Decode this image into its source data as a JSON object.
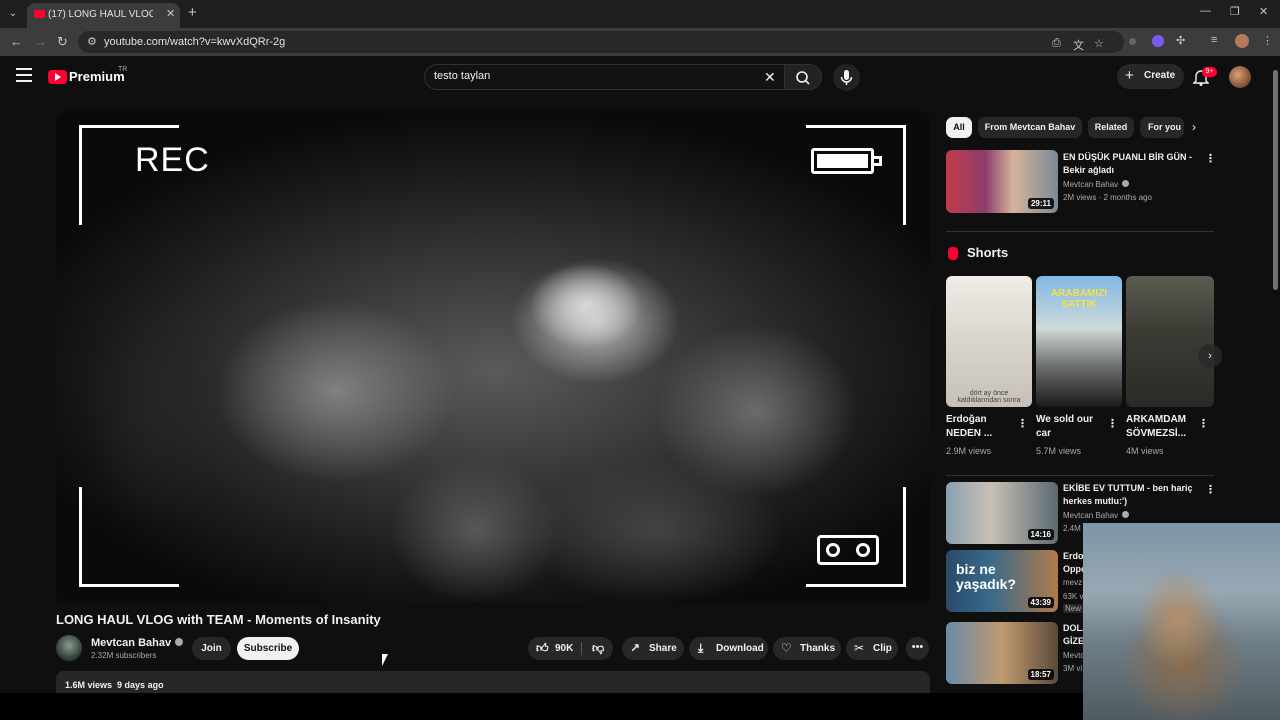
{
  "browser": {
    "tab_title": "(17) LONG HAUL VLOG with TEAM - Moments of Insanity",
    "url": "youtube.com/watch?v=kwvXdQRr-2g",
    "accent": "#3c3c3c"
  },
  "header": {
    "logo_text": "Premium",
    "country_code": "TR",
    "search_value": "testo taylan",
    "create_label": "Create",
    "notification_count": "9+",
    "brand_color": "#ff0033"
  },
  "player": {
    "overlay_rec": "REC"
  },
  "video": {
    "title": "LONG HAUL VLOG with TEAM - Moments of Insanity",
    "channel": "Mevtcan Bahav",
    "subscribers": "2.32M subscribers",
    "join_label": "Join",
    "subscribe_label": "Subscribe",
    "like_count": "90K",
    "share_label": "Share",
    "download_label": "Download",
    "thanks_label": "Thanks",
    "clip_label": "Clip",
    "views": "1.6M views",
    "age": "9 days ago"
  },
  "chips": [
    "All",
    "From Mevtcan Bahav",
    "Related",
    "For you"
  ],
  "recommended": [
    {
      "title": "EN DÜŞÜK PUANLI BİR GÜN - Bekir ağladı",
      "channel": "Mevtcan Bahav",
      "meta": "2M views · 2 months ago",
      "duration": "29:11"
    },
    {
      "title": "EKİBE EV TUTTUM - ben hariç herkes mutlu:')",
      "channel": "Mevtcan Bahav",
      "meta": "2.4M",
      "duration": "14:16"
    },
    {
      "title": "Erdo",
      "title2": "Oppo",
      "channel": "mevz",
      "meta": "63K v",
      "badge": "New",
      "duration": "43:39",
      "overlay": "biz ne yaşadık?"
    },
    {
      "title": "DOLA",
      "title2": "GİZE",
      "channel": "Mevtc",
      "meta": "3M vi",
      "duration": "18:57"
    }
  ],
  "shorts": {
    "heading": "Shorts",
    "items": [
      {
        "title": "Erdoğan NEDEN ...",
        "views": "2.9M views",
        "caption": "dört ay önce kaldıklarından sonra"
      },
      {
        "title": "We sold our car",
        "views": "5.7M views",
        "caption": "ARABAMIZI SATTIK"
      },
      {
        "title": "ARKAMDAM SÖVMEZSİ...",
        "views": "4M views",
        "caption": ""
      }
    ]
  }
}
